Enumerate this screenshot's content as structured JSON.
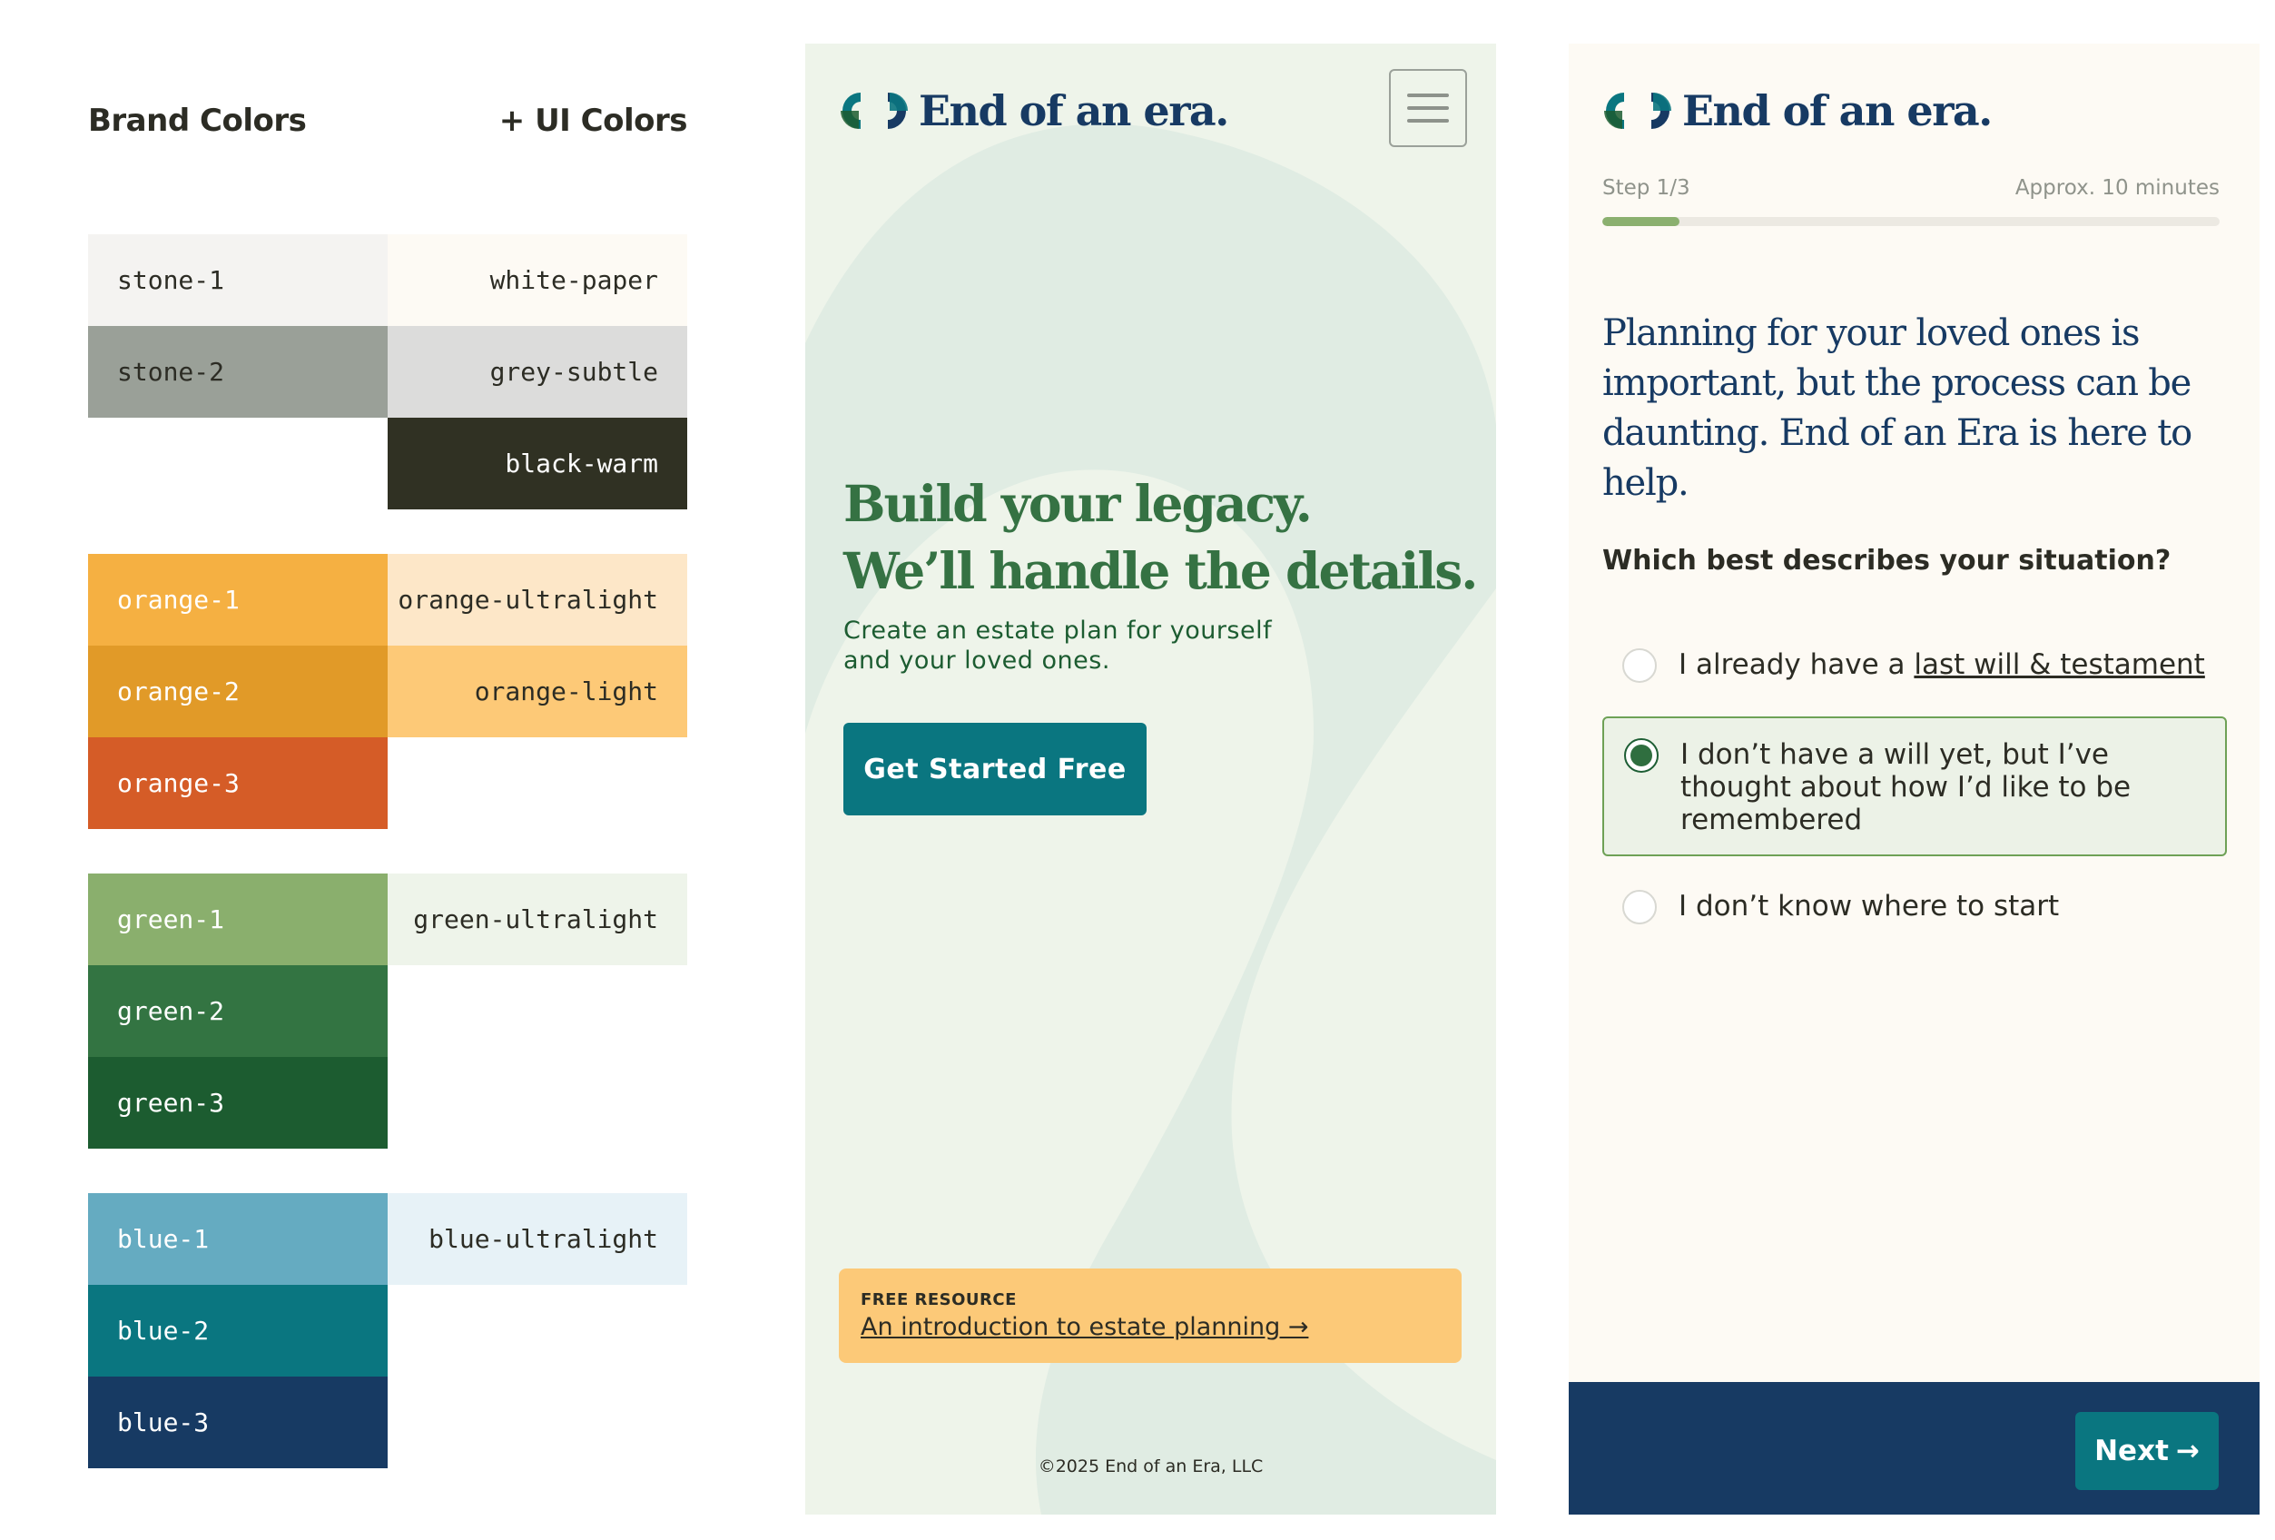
{
  "palette": {
    "brand_header": "Brand Colors",
    "ui_header": "+ UI Colors",
    "swatches": [
      {
        "name": "stone-1",
        "color": "#f4f3f1",
        "text_color": "#2c2c24"
      },
      {
        "name": "white-paper",
        "color": "#fdfaf4",
        "text_color": "#2c2c24"
      },
      {
        "name": "stone-2",
        "color": "#9aa098",
        "text_color": "#2c2c24"
      },
      {
        "name": "grey-subtle",
        "color": "#dcdcdb",
        "text_color": "#2c2c24"
      },
      {
        "name": "black-warm",
        "color": "#303123",
        "text_color": "#ffffff"
      },
      {
        "name": "orange-1",
        "color": "#f5b042",
        "text_color": "#ffffff"
      },
      {
        "name": "orange-ultralight",
        "color": "#fde7c8",
        "text_color": "#2c2c24"
      },
      {
        "name": "orange-2",
        "color": "#e19a28",
        "text_color": "#ffffff"
      },
      {
        "name": "orange-light",
        "color": "#fdc977",
        "text_color": "#2c2c24"
      },
      {
        "name": "orange-3",
        "color": "#d55c27",
        "text_color": "#ffffff"
      },
      {
        "name": "green-1",
        "color": "#8aaf6d",
        "text_color": "#ffffff"
      },
      {
        "name": "green-ultralight",
        "color": "#eef4ea",
        "text_color": "#2c2c24"
      },
      {
        "name": "green-2",
        "color": "#337442",
        "text_color": "#ffffff"
      },
      {
        "name": "green-3",
        "color": "#1c5c30",
        "text_color": "#ffffff"
      },
      {
        "name": "blue-1",
        "color": "#65abc1",
        "text_color": "#ffffff"
      },
      {
        "name": "blue-ultralight",
        "color": "#e7f2f7",
        "text_color": "#2c2c24"
      },
      {
        "name": "blue-2",
        "color": "#0a7680",
        "text_color": "#ffffff"
      },
      {
        "name": "blue-3",
        "color": "#173a63",
        "text_color": "#ffffff"
      }
    ]
  },
  "landing": {
    "logo_text": "End of an era.",
    "logo_icon": "two-crescents-logo-icon",
    "menu_icon": "hamburger-menu-icon",
    "hero_line1": "Build your legacy.",
    "hero_line2": "We’ll handle the details.",
    "hero_sub": "Create an estate plan for yourself and your loved ones.",
    "cta_label": "Get Started Free",
    "resource_tag": "FREE RESOURCE",
    "resource_link": "An introduction to estate planning →",
    "copyright": "©2025 End of an Era, LLC",
    "background_color": "#eef4ea",
    "deco_color": "#e0ece3"
  },
  "questionnaire": {
    "logo_text": "End of an era.",
    "logo_icon": "two-crescents-logo-icon",
    "step_label": "Step 1/3",
    "time_label": "Approx. 10 minutes",
    "progress_fraction": 0.125,
    "intro": "Planning for your loved ones is important, but the process can be daunting. End of an Era is here to help.",
    "question": "Which best describes your situation?",
    "options": [
      {
        "prefix": "I already have a ",
        "link": "last will & testament",
        "selected": false
      },
      {
        "label": "I don’t have a will yet, but I’ve thought about how I’d like to be remembered",
        "selected": true
      },
      {
        "label": "I don’t know where to start",
        "selected": false
      }
    ],
    "next_label": "Next",
    "next_icon": "arrow-right-icon"
  }
}
